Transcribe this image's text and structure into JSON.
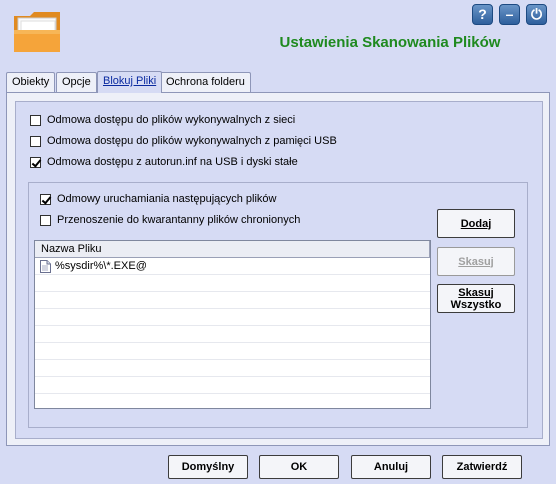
{
  "header": {
    "title": "Ustawienia Skanowania Plików",
    "help_label": "?",
    "minimize_label": "–",
    "power_label": "⏻"
  },
  "tabs": [
    {
      "label": "Obiekty"
    },
    {
      "label": "Opcje"
    },
    {
      "label": "Blokuj Pliki",
      "active": true
    },
    {
      "label": "Ochrona folderu"
    }
  ],
  "options": [
    {
      "label": "Odmowa dostępu do plików wykonywalnych z sieci",
      "checked": false
    },
    {
      "label": "Odmowa dostępu do plików wykonywalnych z pamięci USB",
      "checked": false
    },
    {
      "label": "Odmowa dostępu z autorun.inf na USB i dyski stałe",
      "checked": true
    }
  ],
  "group": {
    "block_label": "Odmowy uruchamiania następujących plików",
    "block_checked": true,
    "quarantine_label": "Przenoszenie do kwarantanny plików chronionych",
    "quarantine_checked": false
  },
  "list": {
    "header": "Nazwa Pliku",
    "items": [
      "%sysdir%\\*.EXE@"
    ]
  },
  "side_buttons": {
    "add": "Dodaj",
    "delete": "Skasuj",
    "delete_all_line1": "Skasuj",
    "delete_all_line2": "Wszystko"
  },
  "footer": {
    "default": "Domyślny",
    "ok": "OK",
    "cancel": "Anuluj",
    "apply": "Zatwierdź"
  },
  "colors": {
    "background": "#d6dbf4",
    "title": "#1f8a1f",
    "active_tab_text": "#0a2aa0",
    "folder": "#f0a030"
  }
}
